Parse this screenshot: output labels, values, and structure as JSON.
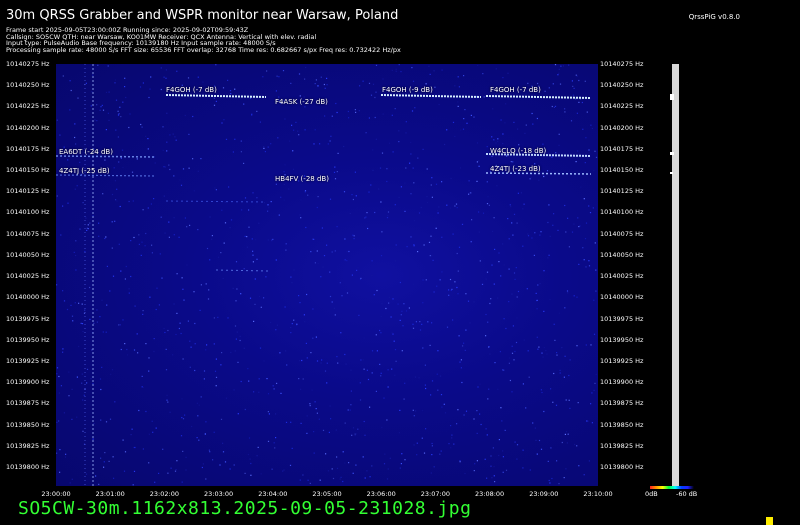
{
  "header": {
    "title": "30m QRSS Grabber and WSPR monitor near Warsaw, Poland",
    "version": "QrssPiG v0.8.0",
    "info_lines": [
      "Frame start 2025-09-05T23:00:00Z Running since: 2025-09-02T09:59:43Z",
      "Callsign: SO5CW QTH: near Warsaw, KO01MW Receiver: QCX Antenna: Vertical with elev. radial",
      "Input type: PulseAudio Base frequency: 10139180 Hz Input sample rate: 48000 S/s",
      "Processing sample rate: 48000 S/s FFT size: 65536 FFT overlap: 32768 Time res: 0.682667 s/px Freq res: 0.732422 Hz/px"
    ]
  },
  "freq_axis": {
    "left_labels": [
      "10140275 Hz",
      "10140250 Hz",
      "10140225 Hz",
      "10140200 Hz",
      "10140175 Hz",
      "10140150 Hz",
      "10140125 Hz",
      "10140100 Hz",
      "10140075 Hz",
      "10140050 Hz",
      "10140025 Hz",
      "10140000 Hz",
      "10139975 Hz",
      "10139950 Hz",
      "10139925 Hz",
      "10139900 Hz",
      "10139875 Hz",
      "10139850 Hz",
      "10139825 Hz",
      "10139800 Hz"
    ],
    "right_labels": [
      "10140275 Hz",
      "10140250 Hz",
      "10140225 Hz",
      "10140200 Hz",
      "10140175 Hz",
      "10140150 Hz",
      "10140125 Hz",
      "10140100 Hz",
      "10140075 Hz",
      "10140050 Hz",
      "10140025 Hz",
      "10140000 Hz",
      "10139975 Hz",
      "10139950 Hz",
      "10139925 Hz",
      "10139900 Hz",
      "10139875 Hz",
      "10139850 Hz",
      "10139825 Hz",
      "10139800 Hz"
    ]
  },
  "time_axis": {
    "labels": [
      "23:00:00",
      "23:01:00",
      "23:02:00",
      "23:03:00",
      "23:04:00",
      "23:05:00",
      "23:06:00",
      "23:07:00",
      "23:08:00",
      "23:09:00",
      "23:10:00"
    ]
  },
  "spots": [
    {
      "label": "F4GOH (-7 dB)"
    },
    {
      "label": "F4GOH (-9 dB)"
    },
    {
      "label": "F4GOH (-7 dB)"
    },
    {
      "label": "F4ASK (-27 dB)"
    },
    {
      "label": "EA6DT (-24 dB)"
    },
    {
      "label": "W4CLQ (-18 dB)"
    },
    {
      "label": "4Z4TJ (-25 dB)"
    },
    {
      "label": "4Z4TJ (-23 dB)"
    },
    {
      "label": "HB4FV (-28 dB)"
    }
  ],
  "colour_scale": {
    "min_label": "0dB",
    "max_label": "-60 dB"
  },
  "footer": {
    "filename": "SO5CW-30m.1162x813.2025-09-05-231028.jpg"
  },
  "colors": {
    "background": "#000000",
    "waterfall": "#0a0a8a",
    "signal": "#c8e8ff",
    "filename": "#33ff33"
  }
}
